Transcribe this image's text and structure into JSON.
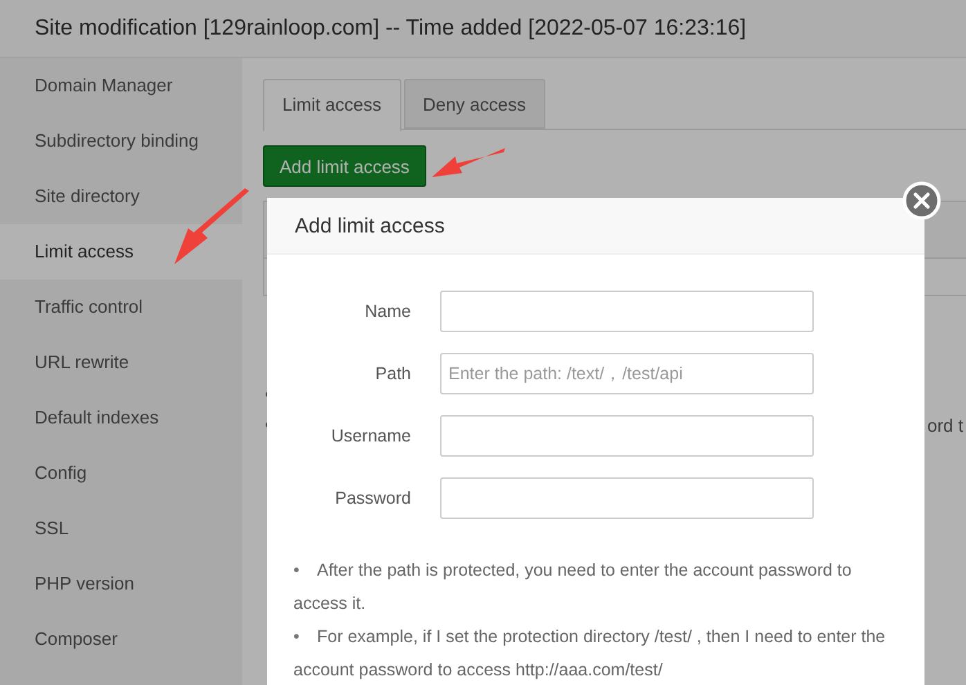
{
  "window": {
    "title": "Site modification [129rainloop.com] -- Time added [2022-05-07 16:23:16]"
  },
  "sidebar": {
    "items": [
      {
        "label": "Domain Manager",
        "selected": false
      },
      {
        "label": "Subdirectory binding",
        "selected": false
      },
      {
        "label": "Site directory",
        "selected": false
      },
      {
        "label": "Limit access",
        "selected": true
      },
      {
        "label": "Traffic control",
        "selected": false
      },
      {
        "label": "URL rewrite",
        "selected": false
      },
      {
        "label": "Default indexes",
        "selected": false
      },
      {
        "label": "Config",
        "selected": false
      },
      {
        "label": "SSL",
        "selected": false
      },
      {
        "label": "PHP version",
        "selected": false
      },
      {
        "label": "Composer",
        "selected": false
      }
    ]
  },
  "tabs": [
    {
      "label": "Limit access",
      "selected": true
    },
    {
      "label": "Deny access",
      "selected": false
    }
  ],
  "add_button": "Add limit access",
  "background_notes": [
    {
      "kind": "bullet"
    },
    {
      "kind": "bullet",
      "visible_text": "ord t"
    }
  ],
  "modal": {
    "title": "Add limit access",
    "fields": [
      {
        "label": "Name"
      },
      {
        "label": "Path",
        "placeholder": "Enter the path: /text/，/test/api"
      },
      {
        "label": "Username"
      },
      {
        "label": "Password"
      }
    ],
    "notes": [
      {
        "bullet": "•",
        "text": "After the path is protected, you need to enter the account password to access it."
      },
      {
        "bullet": "•",
        "text": "For example, if I set the protection directory /test/ , then I need to enter the account password to access http://aaa.com/test/"
      }
    ]
  }
}
